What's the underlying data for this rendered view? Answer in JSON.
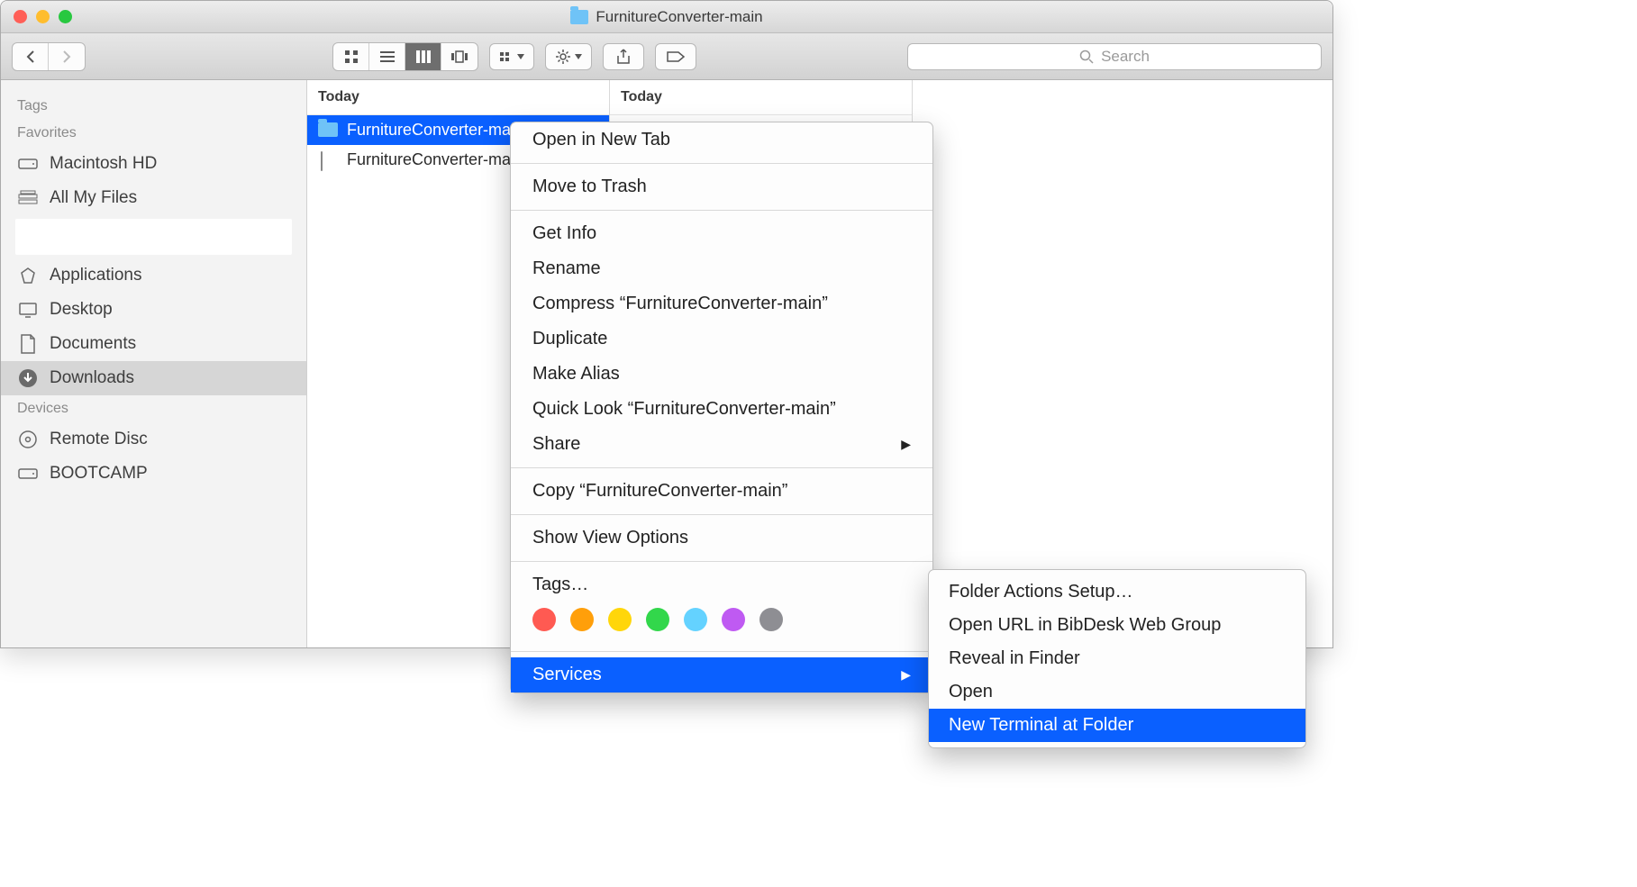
{
  "window": {
    "title": "FurnitureConverter-main"
  },
  "toolbar": {
    "search_placeholder": "Search"
  },
  "sidebar": {
    "sections": [
      {
        "header": "Tags",
        "items": []
      },
      {
        "header": "Favorites",
        "items": [
          {
            "icon": "hd-icon",
            "label": "Macintosh HD"
          },
          {
            "icon": "all-files-icon",
            "label": "All My Files"
          },
          {
            "icon": "blank",
            "label": ""
          },
          {
            "icon": "applications-icon",
            "label": "Applications"
          },
          {
            "icon": "desktop-icon",
            "label": "Desktop"
          },
          {
            "icon": "documents-icon",
            "label": "Documents"
          },
          {
            "icon": "downloads-icon",
            "label": "Downloads",
            "selected": true
          }
        ]
      },
      {
        "header": "Devices",
        "items": [
          {
            "icon": "disc-icon",
            "label": "Remote Disc"
          },
          {
            "icon": "hd-icon",
            "label": "BOOTCAMP"
          }
        ]
      }
    ]
  },
  "columns": [
    {
      "header": "Today",
      "rows": [
        {
          "type": "folder",
          "label": "FurnitureConverter-main",
          "selected": true,
          "has_children": true
        },
        {
          "type": "document",
          "label": "FurnitureConverter-main.zip"
        }
      ]
    },
    {
      "header": "Today",
      "rows": []
    }
  ],
  "context_menu": {
    "groups": [
      [
        {
          "label": "Open in New Tab"
        }
      ],
      [
        {
          "label": "Move to Trash"
        }
      ],
      [
        {
          "label": "Get Info"
        },
        {
          "label": "Rename"
        },
        {
          "label": "Compress “FurnitureConverter-main”"
        },
        {
          "label": "Duplicate"
        },
        {
          "label": "Make Alias"
        },
        {
          "label": "Quick Look “FurnitureConverter-main”"
        },
        {
          "label": "Share",
          "submenu": true
        }
      ],
      [
        {
          "label": "Copy “FurnitureConverter-main”"
        }
      ],
      [
        {
          "label": "Show View Options"
        }
      ],
      [
        {
          "label": "Tags…",
          "tags": true
        }
      ],
      [
        {
          "label": "Services",
          "submenu": true,
          "selected": true
        }
      ]
    ],
    "tag_colors": [
      "#ff5a52",
      "#ff9f0a",
      "#ffd60a",
      "#32d74b",
      "#64d2ff",
      "#bf5af2",
      "#8e8e93"
    ]
  },
  "services_submenu": [
    {
      "label": "Folder Actions Setup…"
    },
    {
      "label": "Open URL in BibDesk Web Group"
    },
    {
      "label": "Reveal in Finder"
    },
    {
      "label": "Open"
    },
    {
      "label": "New Terminal at Folder",
      "selected": true
    }
  ]
}
